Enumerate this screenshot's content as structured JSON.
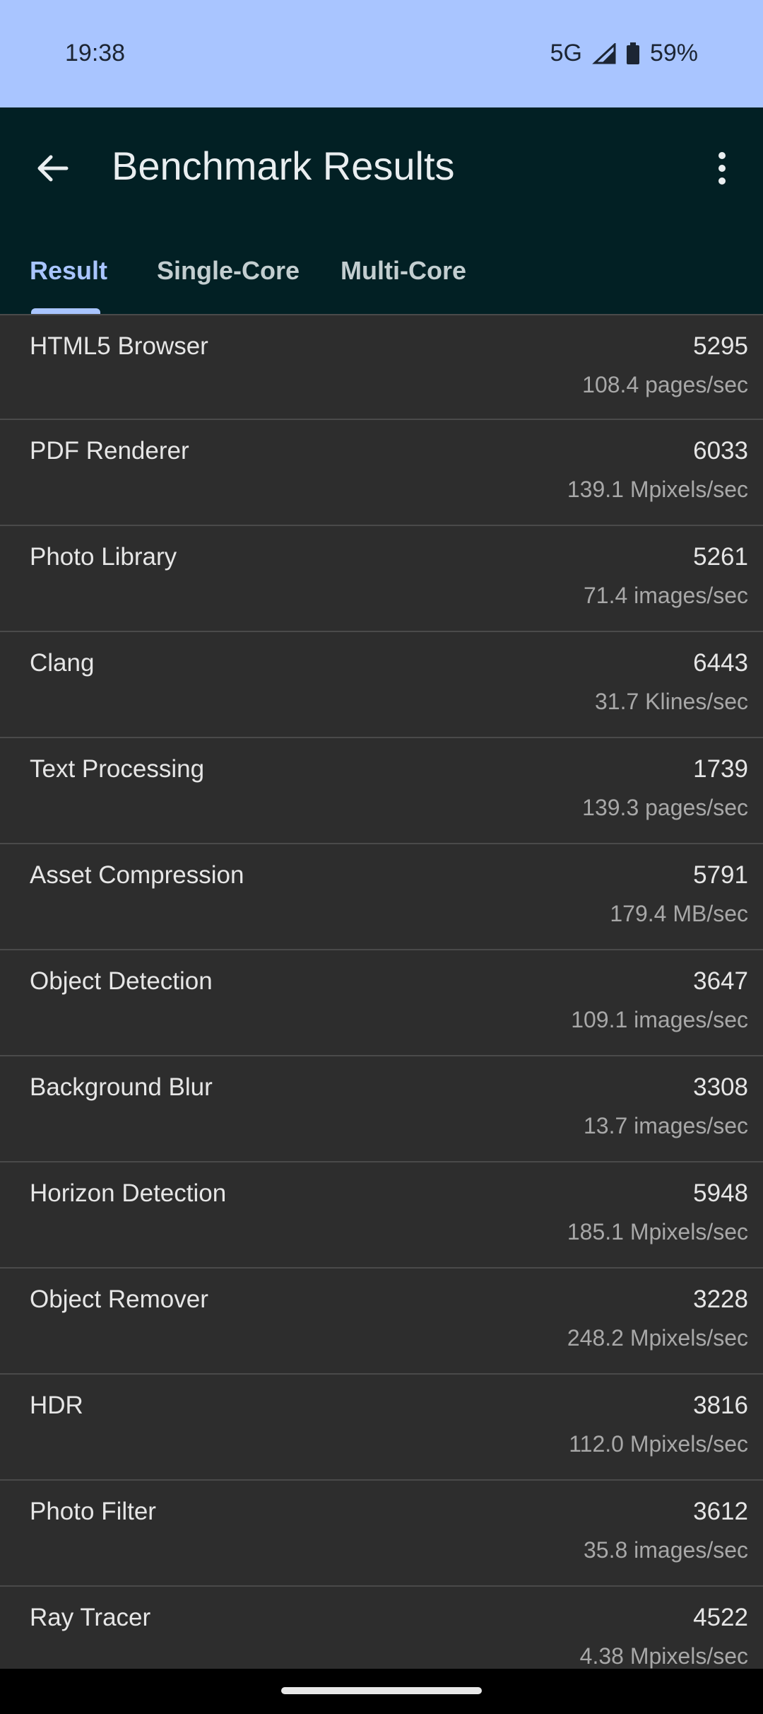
{
  "status_bar": {
    "time": "19:38",
    "network": "5G",
    "battery": "59%"
  },
  "app_bar": {
    "title": "Benchmark Results"
  },
  "tabs": [
    {
      "label": "Result",
      "active": true
    },
    {
      "label": "Single-Core",
      "active": false
    },
    {
      "label": "Multi-Core",
      "active": false
    }
  ],
  "results": [
    {
      "name": "HTML5 Browser",
      "score": "5295",
      "rate": "108.4 pages/sec"
    },
    {
      "name": "PDF Renderer",
      "score": "6033",
      "rate": "139.1 Mpixels/sec"
    },
    {
      "name": "Photo Library",
      "score": "5261",
      "rate": "71.4 images/sec"
    },
    {
      "name": "Clang",
      "score": "6443",
      "rate": "31.7 Klines/sec"
    },
    {
      "name": "Text Processing",
      "score": "1739",
      "rate": "139.3 pages/sec"
    },
    {
      "name": "Asset Compression",
      "score": "5791",
      "rate": "179.4 MB/sec"
    },
    {
      "name": "Object Detection",
      "score": "3647",
      "rate": "109.1 images/sec"
    },
    {
      "name": "Background Blur",
      "score": "3308",
      "rate": "13.7 images/sec"
    },
    {
      "name": "Horizon Detection",
      "score": "5948",
      "rate": "185.1 Mpixels/sec"
    },
    {
      "name": "Object Remover",
      "score": "3228",
      "rate": "248.2 Mpixels/sec"
    },
    {
      "name": "HDR",
      "score": "3816",
      "rate": "112.0 Mpixels/sec"
    },
    {
      "name": "Photo Filter",
      "score": "3612",
      "rate": "35.8 images/sec"
    },
    {
      "name": "Ray Tracer",
      "score": "4522",
      "rate": "4.38 Mpixels/sec"
    }
  ],
  "colors": {
    "status_bar": "#a9c5ff",
    "app_bar": "#022024",
    "accent": "#a9c5ff",
    "list_bg": "#2d2d2d"
  }
}
